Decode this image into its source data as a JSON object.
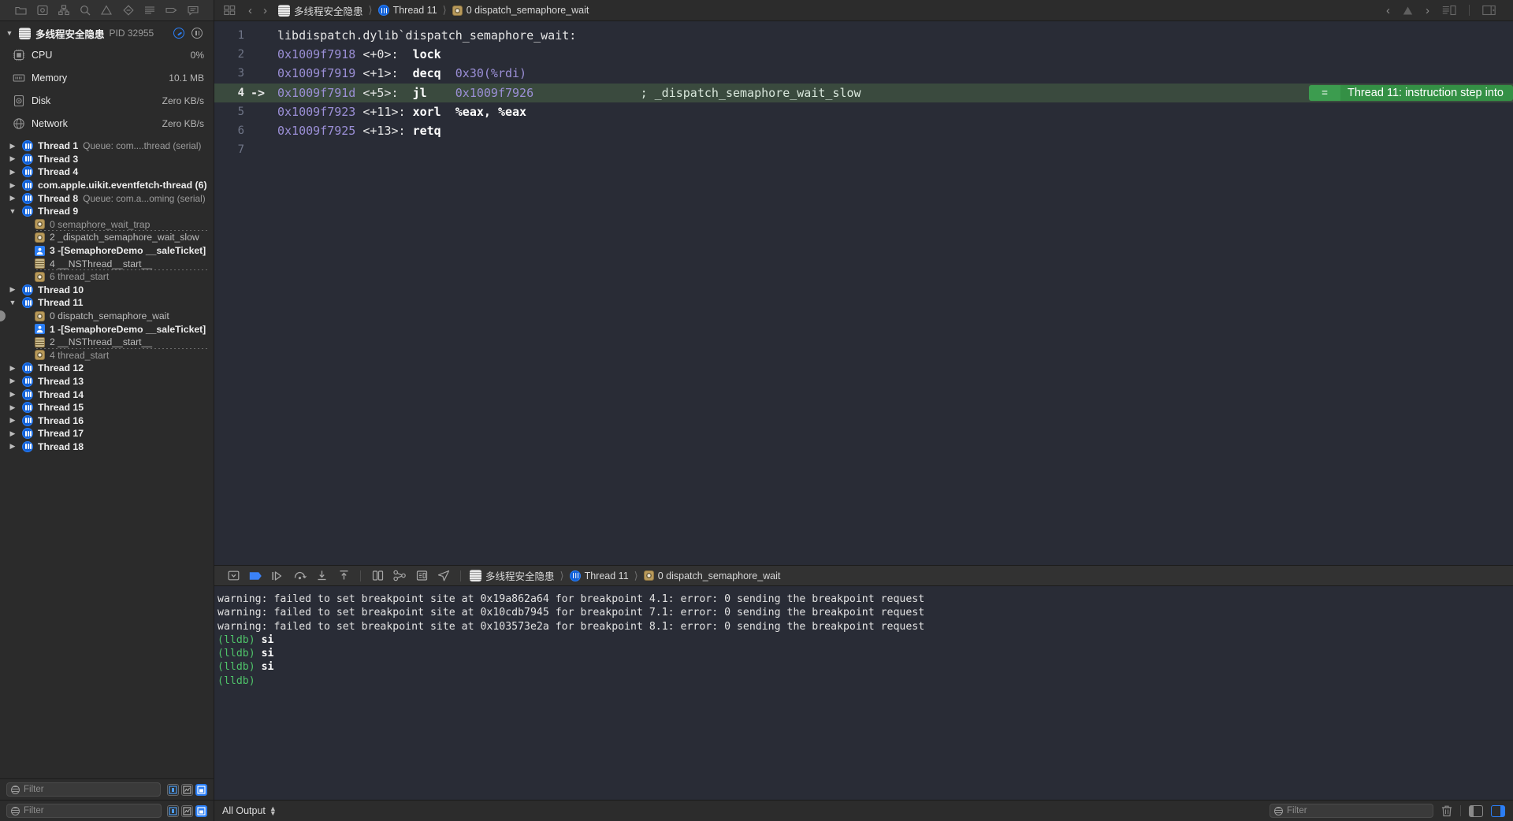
{
  "toolbar": {
    "left_icons": [
      "folder-icon",
      "source-control-icon",
      "hierarchy-icon",
      "search-icon",
      "warning-icon",
      "breakpoint-icon",
      "report-icon",
      "tag-icon",
      "comment-icon"
    ],
    "grid_icon": "panel-grid-icon",
    "back_label": "‹",
    "forward_label": "›",
    "breadcrumb": [
      {
        "icon": "app-icon",
        "label": "多线程安全隐患"
      },
      {
        "icon": "thread-icon",
        "label": "Thread 11"
      },
      {
        "icon": "frame-icon",
        "label": "0 dispatch_semaphore_wait"
      }
    ],
    "right": {
      "prev_issue": "‹",
      "warning_icon": "warning-triangle-icon",
      "next_issue": "›",
      "library_icon": "library-panel-icon",
      "inspector_icon": "inspector-panel-icon"
    }
  },
  "navigator": {
    "process": {
      "name": "多线程安全隐患",
      "pid_label": "PID 32955",
      "disclosure": "▼",
      "actions": [
        "record-icon",
        "pause-icon"
      ]
    },
    "gauges": [
      {
        "icon": "cpu-icon",
        "label": "CPU",
        "value": "0%"
      },
      {
        "icon": "memory-icon",
        "label": "Memory",
        "value": "10.1 MB"
      },
      {
        "icon": "disk-icon",
        "label": "Disk",
        "value": "Zero KB/s"
      },
      {
        "icon": "network-icon",
        "label": "Network",
        "value": "Zero KB/s"
      }
    ],
    "threads": [
      {
        "type": "thread",
        "disclosure": "▶",
        "name": "Thread 1",
        "queue": "Queue: com....thread (serial)"
      },
      {
        "type": "thread",
        "disclosure": "▶",
        "name": "Thread 3",
        "queue": ""
      },
      {
        "type": "thread",
        "disclosure": "▶",
        "name": "Thread 4",
        "queue": ""
      },
      {
        "type": "thread",
        "disclosure": "▶",
        "name": "com.apple.uikit.eventfetch-thread (6)",
        "queue": ""
      },
      {
        "type": "thread",
        "disclosure": "▶",
        "name": "Thread 8",
        "queue": "Queue: com.a...oming (serial)"
      },
      {
        "type": "thread",
        "disclosure": "▼",
        "name": "Thread 9",
        "queue": ""
      },
      {
        "type": "frame",
        "icon": "frame-icon",
        "label": "0 semaphore_wait_trap",
        "style": "dim",
        "dashed": true
      },
      {
        "type": "frame",
        "icon": "frame-icon",
        "label": "2 _dispatch_semaphore_wait_slow",
        "style": "semi",
        "dashed": false
      },
      {
        "type": "frame",
        "icon": "user-icon",
        "label": "3 -[SemaphoreDemo __saleTicket]",
        "style": "bold",
        "dashed": false
      },
      {
        "type": "frame",
        "icon": "list-icon",
        "label": "4 __NSThread__start__",
        "style": "semi",
        "dashed": true
      },
      {
        "type": "frame",
        "icon": "frame-icon",
        "label": "6 thread_start",
        "style": "dim",
        "dashed": false
      },
      {
        "type": "thread",
        "disclosure": "▶",
        "name": "Thread 10",
        "queue": ""
      },
      {
        "type": "thread",
        "disclosure": "▼",
        "name": "Thread 11",
        "queue": ""
      },
      {
        "type": "frame",
        "icon": "frame-icon",
        "label": "0 dispatch_semaphore_wait",
        "style": "semi",
        "dashed": false,
        "selected": true
      },
      {
        "type": "frame",
        "icon": "user-icon",
        "label": "1 -[SemaphoreDemo __saleTicket]",
        "style": "bold",
        "dashed": false
      },
      {
        "type": "frame",
        "icon": "list-icon",
        "label": "2 __NSThread__start__",
        "style": "semi",
        "dashed": true
      },
      {
        "type": "frame",
        "icon": "frame-icon",
        "label": "4 thread_start",
        "style": "dim",
        "dashed": false
      },
      {
        "type": "thread",
        "disclosure": "▶",
        "name": "Thread 12",
        "queue": ""
      },
      {
        "type": "thread",
        "disclosure": "▶",
        "name": "Thread 13",
        "queue": ""
      },
      {
        "type": "thread",
        "disclosure": "▶",
        "name": "Thread 14",
        "queue": ""
      },
      {
        "type": "thread",
        "disclosure": "▶",
        "name": "Thread 15",
        "queue": ""
      },
      {
        "type": "thread",
        "disclosure": "▶",
        "name": "Thread 16",
        "queue": ""
      },
      {
        "type": "thread",
        "disclosure": "▶",
        "name": "Thread 17",
        "queue": ""
      },
      {
        "type": "thread",
        "disclosure": "▶",
        "name": "Thread 18",
        "queue": ""
      }
    ],
    "filter": {
      "placeholder": "Filter",
      "icon": "filter-icon"
    },
    "filter_segments": [
      "show-only-running-icon",
      "show-only-crashed-icon",
      "show-all-icon"
    ]
  },
  "editor": {
    "lines": [
      {
        "no": "1",
        "arrow": "",
        "current": false,
        "addr": "",
        "offset": "",
        "mnemonic": "",
        "operand": "",
        "comment": "",
        "raw": "libdispatch.dylib`dispatch_semaphore_wait:"
      },
      {
        "no": "2",
        "arrow": "",
        "current": false,
        "addr": "0x1009f7918",
        "offset": "<+0>:",
        "mnemonic": "lock",
        "operand": "",
        "comment": ""
      },
      {
        "no": "3",
        "arrow": "",
        "current": false,
        "addr": "0x1009f7919",
        "offset": "<+1>:",
        "mnemonic": "decq",
        "operand": "0x30(%rdi)",
        "comment": ""
      },
      {
        "no": "4",
        "arrow": "->",
        "current": true,
        "addr": "0x1009f791d",
        "offset": "<+5>:",
        "mnemonic": "jl",
        "operand": "0x1009f7926",
        "comment": "; _dispatch_semaphore_wait_slow"
      },
      {
        "no": "5",
        "arrow": "",
        "current": false,
        "addr": "0x1009f7923",
        "offset": "<+11>:",
        "mnemonic": "xorl",
        "operand": "%eax, %eax",
        "comment": ""
      },
      {
        "no": "6",
        "arrow": "",
        "current": false,
        "addr": "0x1009f7925",
        "offset": "<+13>:",
        "mnemonic": "retq",
        "operand": "",
        "comment": ""
      },
      {
        "no": "7",
        "arrow": "",
        "current": false,
        "addr": "",
        "offset": "",
        "mnemonic": "",
        "operand": "",
        "comment": ""
      }
    ],
    "step_badge": {
      "equals": "=",
      "text": "Thread 11: instruction step into"
    }
  },
  "debug_bar": {
    "buttons": [
      "hide-debug-area-icon",
      "deactivate-breakpoints-icon",
      "continue-icon",
      "step-over-icon",
      "step-into-icon",
      "step-out-icon",
      "debug-view-hierarchy-icon",
      "debug-memory-graph-icon",
      "environment-overrides-icon",
      "simulate-location-icon"
    ],
    "breadcrumb": [
      {
        "icon": "app-icon",
        "label": "多线程安全隐患"
      },
      {
        "icon": "thread-icon",
        "label": "Thread 11"
      },
      {
        "icon": "frame-icon",
        "label": "0 dispatch_semaphore_wait"
      }
    ]
  },
  "console": {
    "lines": [
      {
        "kind": "plain",
        "text": "warning: failed to set breakpoint site at 0x19a862a64 for breakpoint 4.1: error: 0 sending the breakpoint request"
      },
      {
        "kind": "plain",
        "text": "warning: failed to set breakpoint site at 0x10cdb7945 for breakpoint 7.1: error: 0 sending the breakpoint request"
      },
      {
        "kind": "plain",
        "text": "warning: failed to set breakpoint site at 0x103573e2a for breakpoint 8.1: error: 0 sending the breakpoint request"
      },
      {
        "kind": "prompt",
        "prompt": "(lldb)",
        "cmd": " si"
      },
      {
        "kind": "prompt",
        "prompt": "(lldb)",
        "cmd": " si"
      },
      {
        "kind": "prompt",
        "prompt": "(lldb)",
        "cmd": " si"
      },
      {
        "kind": "prompt",
        "prompt": "(lldb)",
        "cmd": ""
      }
    ]
  },
  "statusbar": {
    "left_filter": {
      "placeholder": "Filter",
      "icon": "filter-icon"
    },
    "output_scope": "All Output",
    "right_filter": {
      "placeholder": "Filter",
      "icon": "filter-icon"
    },
    "clear_icon": "trash-icon",
    "panel_toggles": [
      "show-console-only-icon",
      "show-variables-only-icon"
    ]
  },
  "colors": {
    "accent_blue": "#2b7ef5",
    "step_green": "#349045",
    "current_line_bg": "#3a4a3e",
    "editor_bg": "#292c36",
    "prompt_green": "#4fc36a",
    "address_purple": "#9b8fd6"
  }
}
